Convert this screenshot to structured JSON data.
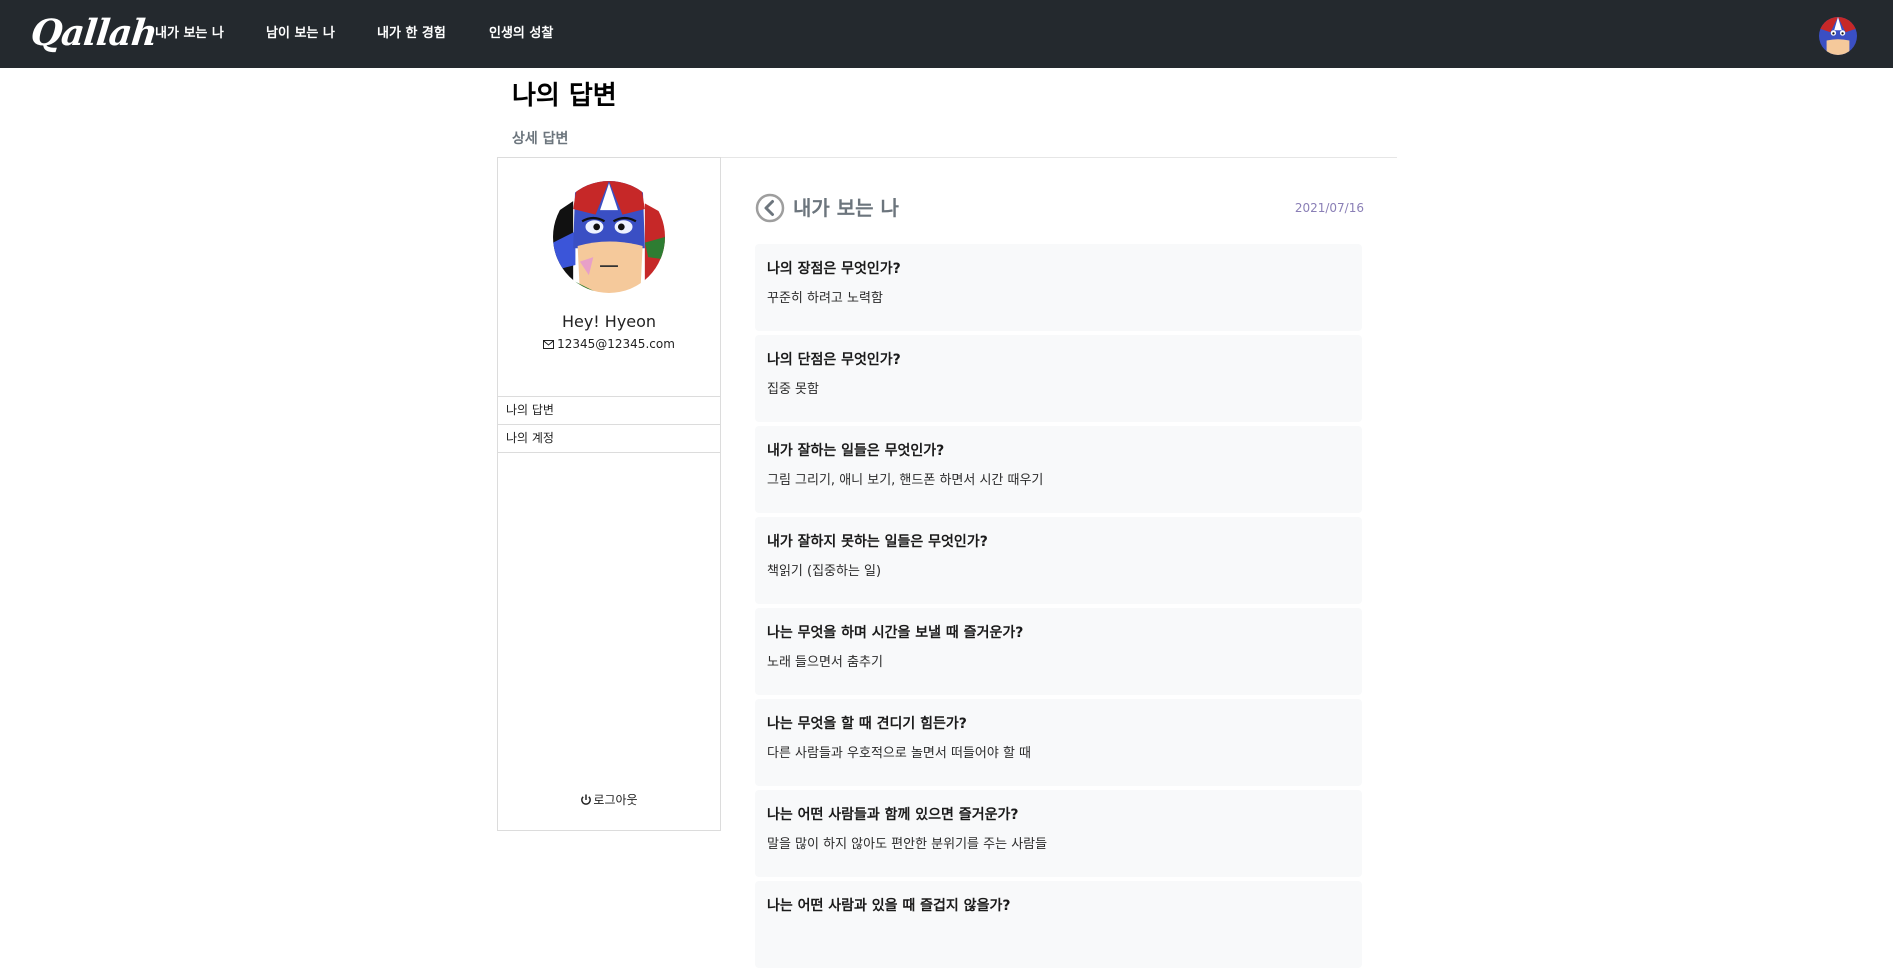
{
  "navbar": {
    "logo": "Qallah",
    "links": [
      {
        "label": "내가 보는 나"
      },
      {
        "label": "남이 보는 나"
      },
      {
        "label": "내가 한 경험"
      },
      {
        "label": "인생의 성찰"
      }
    ],
    "avatar_icon": "user-avatar"
  },
  "page": {
    "title": "나의 답변",
    "subtitle": "상세 답변"
  },
  "sidebar": {
    "profile": {
      "name": "Hey! Hyeon",
      "email": "12345@12345.com",
      "email_icon": "envelope-icon"
    },
    "menu": [
      {
        "label": "나의 답변"
      },
      {
        "label": "나의 계정"
      }
    ],
    "logout": {
      "label": "로그아웃",
      "icon": "power-icon"
    }
  },
  "main": {
    "back_icon": "chevron-left-circle-icon",
    "section_title": "내가 보는 나",
    "date": "2021/07/16",
    "qa": [
      {
        "q": "나의 장점은 무엇인가?",
        "a": "꾸준히 하려고 노력함"
      },
      {
        "q": "나의 단점은 무엇인가?",
        "a": "집중 못함"
      },
      {
        "q": "내가 잘하는 일들은 무엇인가?",
        "a": "그림 그리기, 애니 보기, 핸드폰 하면서 시간 때우기"
      },
      {
        "q": "내가 잘하지 못하는 일들은 무엇인가?",
        "a": "책읽기 (집중하는 일)"
      },
      {
        "q": "나는 무엇을 하며 시간을 보낼 때 즐거운가?",
        "a": "노래 들으면서 춤추기"
      },
      {
        "q": "나는 무엇을 할 때 견디기 힘든가?",
        "a": "다른 사람들과 우호적으로 놀면서 떠들어야 할 때"
      },
      {
        "q": "나는 어떤 사람들과 함께 있으면 즐거운가?",
        "a": "말을 많이 하지 않아도 편안한 분위기를 주는 사람들"
      },
      {
        "q": "나는 어떤 사람과 있을 때 즐겁지 않을가?",
        "a": ""
      }
    ]
  },
  "colors": {
    "navbar_bg": "#24292e",
    "card_bg": "#f8f9fa",
    "date": "#8a7fb6",
    "muted": "#6c757d"
  }
}
